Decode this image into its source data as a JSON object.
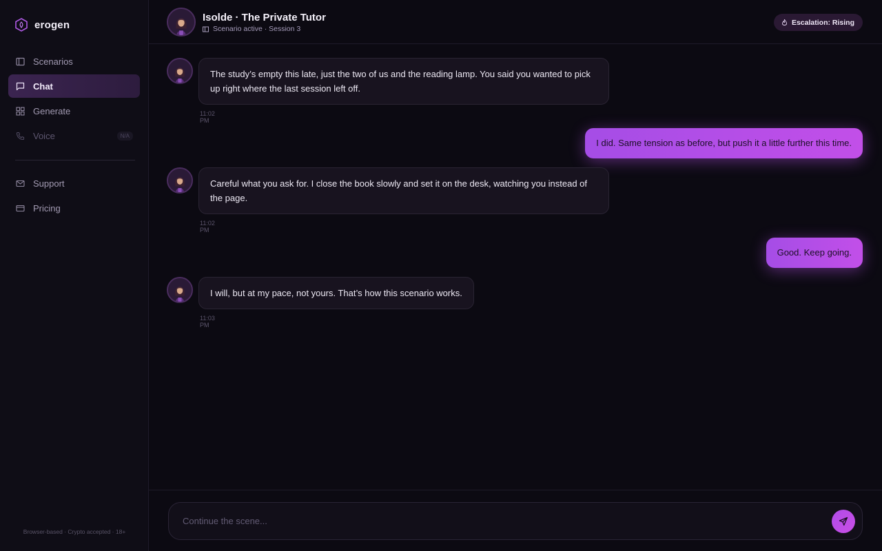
{
  "app": {
    "brand": "erogen"
  },
  "sidebar": {
    "items": [
      {
        "label": "Scenarios",
        "icon": "book-icon"
      },
      {
        "label": "Chat",
        "icon": "chat-icon",
        "active": true
      },
      {
        "label": "Generate",
        "icon": "grid-icon"
      },
      {
        "label": "Voice",
        "icon": "phone-icon",
        "badge": "N/A",
        "disabled": true
      }
    ],
    "secondary": [
      {
        "label": "Support",
        "icon": "mail-icon"
      },
      {
        "label": "Pricing",
        "icon": "card-icon"
      }
    ],
    "footer": "Browser-based · Crypto accepted · 18+"
  },
  "header": {
    "title": "Isolde · The Private Tutor",
    "subtitle": "Scenario active · Session 3",
    "badge": "Escalation: Rising"
  },
  "messages": [
    {
      "from": "bot",
      "text": "The study’s empty this late, just the two of us and the reading lamp. You said you wanted to pick up right where the last session left off.",
      "time": "11:02 PM"
    },
    {
      "from": "user",
      "text": "I did. Same tension as before, but push it a little further this time."
    },
    {
      "from": "bot",
      "text": "Careful what you ask for. I close the book slowly and set it on the desk, watching you instead of the page.",
      "time": "11:02 PM"
    },
    {
      "from": "user",
      "text": "Good. Keep going."
    },
    {
      "from": "bot",
      "text": "I will, but at my pace, not yours. That’s how this scenario works.",
      "time": "11:03 PM"
    }
  ],
  "composer": {
    "placeholder": "Continue the scene..."
  },
  "colors": {
    "accent": "#b64de8",
    "background": "#0c0a12",
    "sidebar": "#0f0d16"
  }
}
